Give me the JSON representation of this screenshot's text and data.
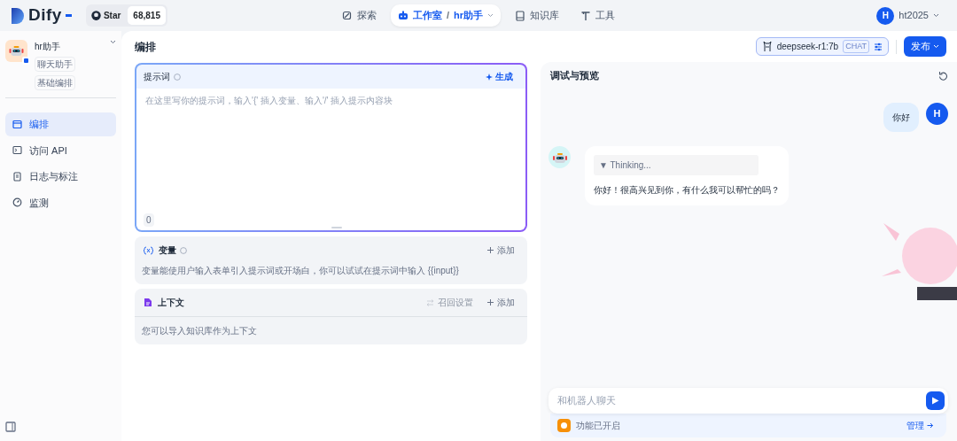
{
  "brand": {
    "name": "Dify"
  },
  "github": {
    "label": "Star",
    "count": "68,815"
  },
  "nav": [
    {
      "label": "探索",
      "kind": "explore",
      "selected": false
    },
    {
      "label": "工作室",
      "kind": "studio",
      "selected": true,
      "separator": "/",
      "crumb": "hr助手"
    },
    {
      "label": "知识库",
      "kind": "knowledge",
      "selected": false
    },
    {
      "label": "工具",
      "kind": "tools",
      "selected": false
    }
  ],
  "user": {
    "initial": "H",
    "name": "ht2025"
  },
  "app": {
    "name": "hr助手",
    "tags": [
      "聊天助手",
      "基础编排"
    ]
  },
  "sidebar": {
    "items": [
      {
        "label": "编排",
        "kind": "layout",
        "selected": true
      },
      {
        "label": "访问 API",
        "kind": "terminal",
        "selected": false
      },
      {
        "label": "日志与标注",
        "kind": "log",
        "selected": false
      },
      {
        "label": "监测",
        "kind": "gauge",
        "selected": false
      }
    ]
  },
  "page_title": "编排",
  "model": {
    "name": "deepseek-r1:7b",
    "badge": "CHAT"
  },
  "publish": "发布",
  "prompt": {
    "title": "提示词",
    "generate": "生成",
    "placeholder": "在这里写你的提示词，输入'{' 插入变量、输入'/' 插入提示内容块",
    "count": "0"
  },
  "variables": {
    "title": "变量",
    "add": "添加",
    "description": "变量能使用户输入表单引入提示词或开场白，你可以试试在提示词中输入 {{input}}"
  },
  "context": {
    "title": "上下文",
    "settings": {
      "label": "召回设置",
      "disabled": true
    },
    "add": "添加",
    "description": "您可以导入知识库作为上下文"
  },
  "preview": {
    "title": "调试与预览",
    "messages": [
      {
        "kind": "user",
        "avatar": "H",
        "text": "你好"
      },
      {
        "kind": "bot",
        "thinking": "▼ Thinking...",
        "text": "你好！很高兴见到你，有什么我可以帮忙的吗？"
      }
    ],
    "input_placeholder": "和机器人聊天",
    "features": "功能已开启",
    "manage": "管理"
  }
}
